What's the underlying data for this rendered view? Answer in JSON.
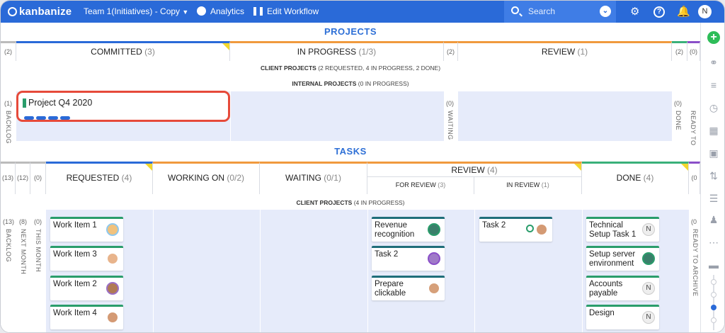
{
  "topbar": {
    "logo": "kanbanize",
    "workspace": "Team 1(Initiatives) - Copy",
    "analytics": "Analytics",
    "edit_workflow": "Edit Workflow",
    "search_placeholder": "Search",
    "user_initial": "N"
  },
  "projects": {
    "title": "PROJECTS",
    "left_count": "(2)",
    "columns": [
      {
        "label": "COMMITTED",
        "count": "(3)"
      },
      {
        "label": "IN PROGRESS",
        "count": "(1/3)"
      },
      {
        "label": "REVIEW",
        "count": "(1)"
      }
    ],
    "mid_count_a": "(2)",
    "mid_count_b": "(2)",
    "right_count": "(0)",
    "lane_client": "CLIENT PROJECTS",
    "lane_client_detail": "(2 REQUESTED, 4 IN PROGRESS, 2 DONE)",
    "lane_internal": "INTERNAL PROJECTS",
    "lane_internal_detail": "(0 IN PROGRESS)",
    "backlog_count": "(1)",
    "backlog_label": "BACKLOG",
    "waiting_count": "(0)",
    "waiting_label": "WAITING",
    "done_count": "(0)",
    "done_label": "DONE",
    "ready_label": "READY TO",
    "card_title": "Project Q4 2020"
  },
  "tasks": {
    "title": "TASKS",
    "counts": [
      "(13)",
      "(12)",
      "(0)"
    ],
    "requested": {
      "label": "REQUESTED",
      "count": "(4)"
    },
    "working_on": {
      "label": "WORKING ON",
      "count": "(0/2)"
    },
    "waiting": {
      "label": "WAITING",
      "count": "(0/1)"
    },
    "review": {
      "label": "REVIEW",
      "count": "(4)"
    },
    "for_review": {
      "label": "FOR REVIEW",
      "count": "(3)"
    },
    "in_review": {
      "label": "IN REVIEW",
      "count": "(1)"
    },
    "done": {
      "label": "DONE",
      "count": "(4)"
    },
    "right_count": "(0",
    "lane_client": "CLIENT PROJECTS",
    "lane_client_detail": "(4 IN PROGRESS)",
    "backlog": {
      "count": "(13)",
      "label": "BACKLOG"
    },
    "next_month": {
      "count": "(8)",
      "label": "NEXT MONTH"
    },
    "this_month": {
      "count": "(0)",
      "label": "THIS MONTH"
    },
    "ready_to_archive": {
      "count": "(0",
      "label": "READY TO ARCHIVE"
    },
    "requested_cards": [
      "Work Item 1",
      "Work Item 3",
      "Work Item 2",
      "Work Item 4"
    ],
    "for_review_cards": [
      "Revenue recognition",
      "Task 2",
      "Prepare clickable"
    ],
    "in_review_cards": [
      "Task 2"
    ],
    "done_cards": [
      "Technical Setup Task 1",
      "Setup server environment",
      "Accounts payable",
      "Design"
    ],
    "done_badge": "N"
  },
  "colors": {
    "topbar": "#2a6ad8",
    "card_accent": "#2a9d6b",
    "lane_bg": "#e6ebfa",
    "highlight": "#e64a3a"
  }
}
